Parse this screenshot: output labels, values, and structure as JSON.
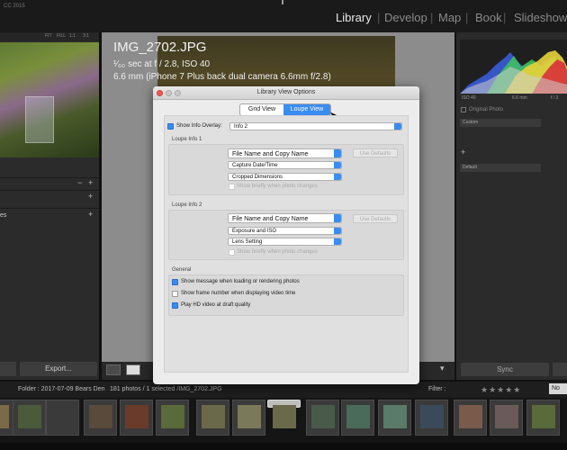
{
  "app": {
    "version": "CC 2015"
  },
  "modules": [
    "Library",
    "Develop",
    "Map",
    "Book",
    "Slideshow"
  ],
  "active_module": "Library",
  "navigator": {
    "zoom_options": [
      "FIT",
      "FILL",
      "1:1",
      "3:1"
    ]
  },
  "left_panel": {
    "partial_label": "es",
    "export_label": "Export..."
  },
  "photo_overlay": {
    "filename": "IMG_2702.JPG",
    "line2": "¹⁄₆₀ sec at f / 2.8, ISO 40",
    "line3": "6.6 mm (iPhone 7 Plus back dual camera 6.6mm f/2.8)"
  },
  "histogram": {
    "iso": "ISO 40",
    "focal": "6.6 mm",
    "aperture": "f / 2"
  },
  "right_panel": {
    "original_photo": "Original Photo",
    "custom": "Custom",
    "default": "Default",
    "sync": "Sync"
  },
  "dialog": {
    "title": "Library View Options",
    "tabs": [
      "Grid View",
      "Loupe View"
    ],
    "active_tab": "Loupe View",
    "show_info_overlay": {
      "label": "Show Info Overlay:",
      "checked": true,
      "value": "Info 2"
    },
    "loupe_info_1": {
      "title": "Loupe Info 1",
      "fields": [
        "File Name and Copy Name",
        "Capture Date/Time",
        "Cropped Dimensions"
      ],
      "use_defaults": "Use Defaults",
      "show_briefly": "Show briefly when photo changes",
      "show_briefly_checked": false
    },
    "loupe_info_2": {
      "title": "Loupe Info 2",
      "fields": [
        "File Name and Copy Name",
        "Exposure and ISO",
        "Lens Setting"
      ],
      "use_defaults": "Use Defaults",
      "show_briefly": "Show briefly when photo changes",
      "show_briefly_checked": false
    },
    "general": {
      "title": "General",
      "options": [
        {
          "label": "Show message when loading or rendering photos",
          "checked": true
        },
        {
          "label": "Show frame number when displaying video time",
          "checked": false
        },
        {
          "label": "Play HD video at draft quality",
          "checked": true
        }
      ]
    }
  },
  "filmstrip": {
    "folder": "Folder : 2017-07-09 Bears Den",
    "status": "181 photos / 1 selected /IMG_2702.JPG",
    "filter_label": "Filter :",
    "stars": "★★★★★",
    "no_filter": "No"
  },
  "colors": {
    "accent": "#3a8cf0",
    "panel": "#2b2b2b",
    "close": "#ee5a52"
  }
}
